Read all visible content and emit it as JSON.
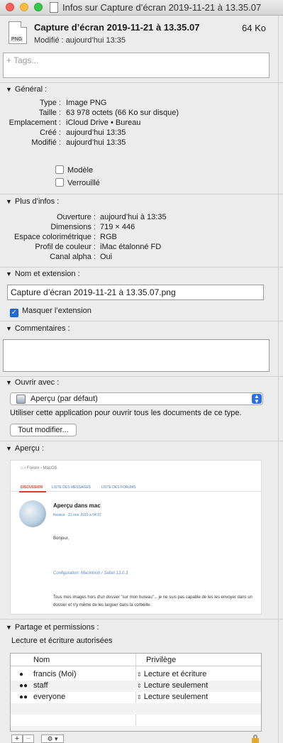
{
  "window": {
    "title": "Infos sur Capture d’écran 2019-11-21 à 13.35.07"
  },
  "header": {
    "file_badge": "PNG",
    "file_name": "Capture d’écran 2019-11-21 à 13.35.07",
    "file_size": "64 Ko",
    "modified_line": "Modifié :  aujourd’hui 13:35"
  },
  "tags": {
    "placeholder": "+ Tags..."
  },
  "general": {
    "heading": "Général :",
    "rows": [
      {
        "k": "Type :",
        "v": "Image PNG"
      },
      {
        "k": "Taille :",
        "v": "63 978 octets (66 Ko sur disque)"
      },
      {
        "k": "Emplacement :",
        "v": "iCloud Drive • Bureau"
      },
      {
        "k": "Créé :",
        "v": "aujourd’hui 13:35"
      },
      {
        "k": "Modifié :",
        "v": "aujourd’hui 13:35"
      }
    ],
    "modele_label": "Modèle",
    "verrouille_label": "Verrouillé"
  },
  "more_info": {
    "heading": "Plus d’infos :",
    "rows": [
      {
        "k": "Ouverture :",
        "v": "aujourd’hui à 13:35"
      },
      {
        "k": "Dimensions :",
        "v": "719 × 446"
      },
      {
        "k": "Espace colorimétrique :",
        "v": "RGB"
      },
      {
        "k": "Profil de couleur :",
        "v": "iMac étalonné FD"
      },
      {
        "k": "Canal alpha :",
        "v": "Oui"
      }
    ]
  },
  "name_ext": {
    "heading": "Nom et extension :",
    "value": "Capture d’écran 2019-11-21 à 13.35.07.png",
    "hide_ext_label": "Masquer l’extension",
    "hide_ext_checked": true
  },
  "comments": {
    "heading": "Commentaires :",
    "value": ""
  },
  "open_with": {
    "heading": "Ouvrir avec :",
    "selected_app": "Aperçu (par défaut)",
    "description": "Utiliser cette application pour ouvrir tous les documents de ce type.",
    "change_all_label": "Tout modifier..."
  },
  "preview": {
    "heading": "Aperçu :",
    "breadcrumb": "⌂ › Forum › MacOS",
    "tabs": [
      "DISCUSSION",
      "LISTE DES MESSAGES",
      "LISTE DES FORUMS"
    ],
    "post_title": "Aperçu dans mac",
    "post_meta": "freunce · 21 nov. 2019 à 04:37",
    "greeting": "Bonjour,",
    "config": "Configuration: Macintosh / Safari 13.0.3",
    "body": "Tous mes images hors d'un dossier \"sur mon bureau\"... je ne suis pas capable de les les envoyer dans un dossier et n'y même de les larguer dans la corbeille."
  },
  "permissions": {
    "heading": "Partage et permissions :",
    "status": "Lecture et écriture autorisées",
    "col_name": "Nom",
    "col_priv": "Privilège",
    "rows": [
      {
        "name": "francis (Moi)",
        "priv": "Lecture et écriture",
        "icon": "user-icon"
      },
      {
        "name": "staff",
        "priv": "Lecture seulement",
        "icon": "group-icon"
      },
      {
        "name": "everyone",
        "priv": "Lecture seulement",
        "icon": "everyone-icon"
      }
    ],
    "add_label": "+",
    "remove_label": "−",
    "action_label": "⚙ ▾"
  }
}
